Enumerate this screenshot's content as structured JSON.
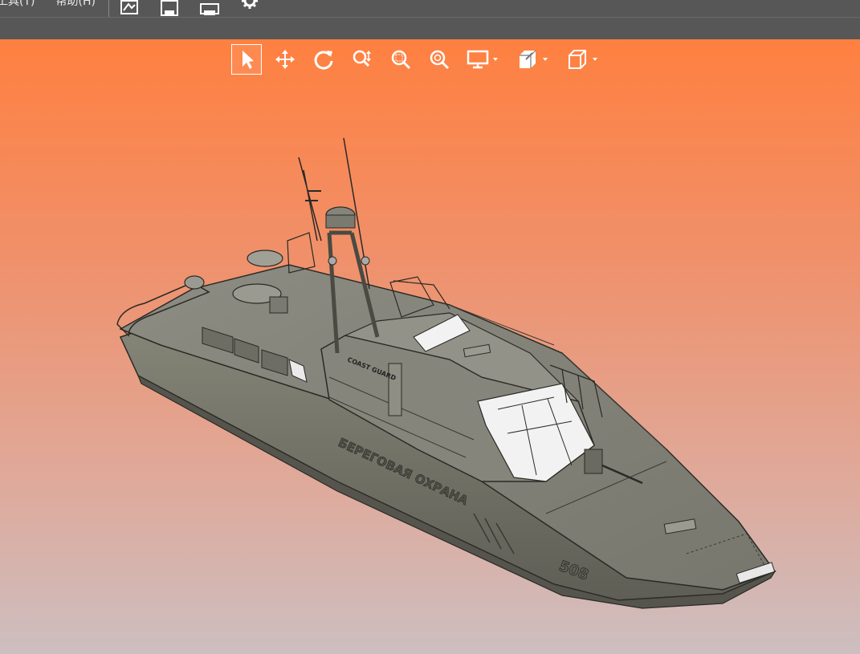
{
  "menubar": {
    "items": [
      {
        "id": "tools",
        "label": "工具(T)"
      },
      {
        "id": "help",
        "label": "帮助(H)"
      }
    ],
    "icons": [
      "image-icon",
      "save-icon",
      "print-icon",
      "settings-icon"
    ]
  },
  "view_toolbar": {
    "tools": [
      {
        "name": "select-tool",
        "icon": "cursor-icon",
        "active": true
      },
      {
        "name": "pan-tool",
        "icon": "move-icon"
      },
      {
        "name": "rotate-tool",
        "icon": "rotate-icon"
      },
      {
        "name": "zoom-tool",
        "icon": "zoom-updown-icon"
      },
      {
        "name": "zoom-window-tool",
        "icon": "zoom-window-icon"
      },
      {
        "name": "zoom-fit-tool",
        "icon": "zoom-fit-icon"
      },
      {
        "name": "display-mode-tool",
        "icon": "monitor-icon",
        "dropdown": true
      },
      {
        "name": "section-tool",
        "icon": "section-cube-icon",
        "dropdown": true
      },
      {
        "name": "view-orientation-tool",
        "icon": "wire-cube-icon",
        "dropdown": true
      }
    ]
  },
  "model": {
    "hull_side_text": "БЕРЕГОВАЯ ОХРАНА",
    "hull_number": "508",
    "cabin_text": "COAST GUARD"
  },
  "colors": {
    "chrome": "#575757",
    "gradient_top": "#ff8040",
    "gradient_bottom": "#cdbec0",
    "hull": "#7a7a6e",
    "deck": "#8a8a80"
  }
}
